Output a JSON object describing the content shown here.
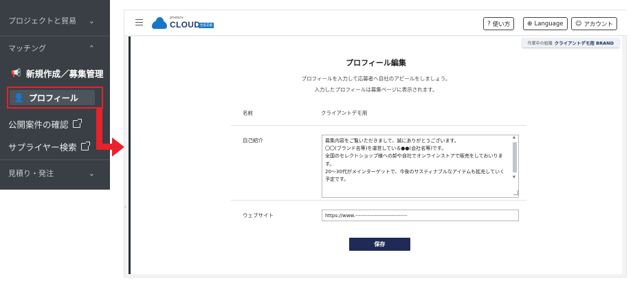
{
  "sidebar": {
    "sections": [
      {
        "label": "プロジェクトと貿易",
        "chevron": "chevron-down"
      },
      {
        "label": "マッチング",
        "chevron": "chevron-up"
      }
    ],
    "items": {
      "new_recruit": "新規作成／募集管理",
      "profile": "プロフィール",
      "public_check": "公開案件の確認",
      "supplier_search": "サプライヤー検索",
      "quote_order": "見積り・発注"
    }
  },
  "header": {
    "logo_pre": "photoru",
    "logo_word": "CLOUD",
    "logo_tag": "生産支援",
    "help_label": "使い方",
    "language_label": "Language",
    "account_label": "アカウント"
  },
  "org": {
    "label": "作業中の組織",
    "name": "クライアントデモ用 BRAND"
  },
  "page": {
    "title": "プロフィール編集",
    "lead1": "プロフィールを入力して応募者へ自社のアピールをしましょう。",
    "lead2": "入力したプロフィールは募集ページに表示されます。"
  },
  "form": {
    "name_label": "名前",
    "name_value": "クライアントデモ用",
    "intro_label": "自己紹介",
    "intro_lines": [
      "募集内容をご覧いただきまして、誠にありがとうございます。",
      "〇〇(ブランド名等)を運営している●●(会社名等)です。",
      "全国のセレクトショップ様への卸や自社でオンラインストアで販売をしておいります。",
      "20〜30代がメインターゲットで、今後のサスティナブルなアイテムも拡充していく予定です。"
    ],
    "website_label": "ウェブサイト",
    "website_value": "https://www.------------------------------",
    "save_label": "保存"
  },
  "colors": {
    "sidebar_bg": "#3a3f45",
    "highlight": "#e8212b",
    "brand_blue": "#1876c7",
    "save_button": "#1f2a55"
  }
}
